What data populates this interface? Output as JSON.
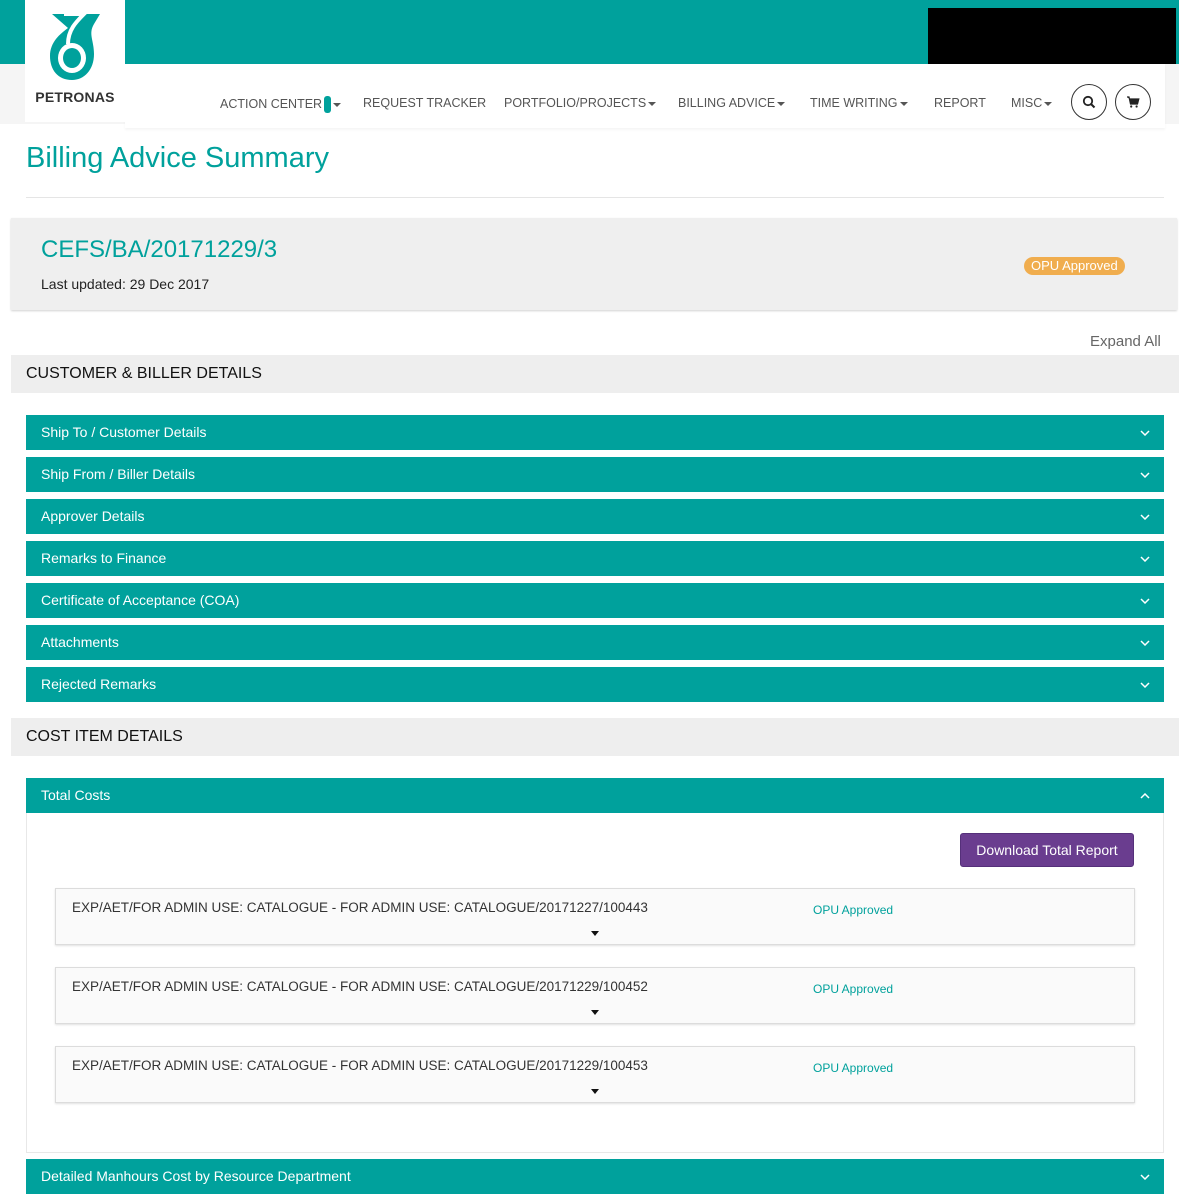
{
  "brand": {
    "name": "PETRONAS",
    "color": "#00a19c"
  },
  "nav": {
    "items": [
      {
        "label": "ACTION CENTER",
        "dropdown": true,
        "badge": true
      },
      {
        "label": "REQUEST TRACKER",
        "dropdown": false
      },
      {
        "label": "PORTFOLIO/PROJECTS",
        "dropdown": true
      },
      {
        "label": "BILLING ADVICE",
        "dropdown": true
      },
      {
        "label": "TIME WRITING",
        "dropdown": true
      },
      {
        "label": "REPORT",
        "dropdown": false
      },
      {
        "label": "MISC",
        "dropdown": true
      }
    ],
    "search_icon": "search-icon",
    "cart_icon": "cart-icon"
  },
  "page": {
    "title": "Billing Advice Summary"
  },
  "billing_advice": {
    "id": "CEFS/BA/20171229/3",
    "last_updated": "Last updated: 29 Dec 2017",
    "status": "OPU Approved",
    "status_color": "#f0ad4e"
  },
  "expand_all": "Expand All",
  "sections": {
    "customer": {
      "title": "CUSTOMER & BILLER DETAILS",
      "items": [
        "Ship To / Customer Details",
        "Ship From / Biller Details",
        "Approver Details",
        "Remarks to Finance",
        "Certificate of Acceptance (COA)",
        "Attachments",
        "Rejected Remarks"
      ]
    },
    "cost": {
      "title": "COST ITEM DETAILS",
      "total_costs": {
        "label": "Total Costs",
        "download_label": "Download Total Report",
        "rows": [
          {
            "ref": "EXP/AET/FOR ADMIN USE: CATALOGUE - FOR ADMIN USE: CATALOGUE/20171227/100443",
            "status": "OPU Approved"
          },
          {
            "ref": "EXP/AET/FOR ADMIN USE: CATALOGUE - FOR ADMIN USE: CATALOGUE/20171229/100452",
            "status": "OPU Approved"
          },
          {
            "ref": "EXP/AET/FOR ADMIN USE: CATALOGUE - FOR ADMIN USE: CATALOGUE/20171229/100453",
            "status": "OPU Approved"
          }
        ]
      },
      "manhours_label": "Detailed Manhours Cost by Resource Department"
    }
  }
}
